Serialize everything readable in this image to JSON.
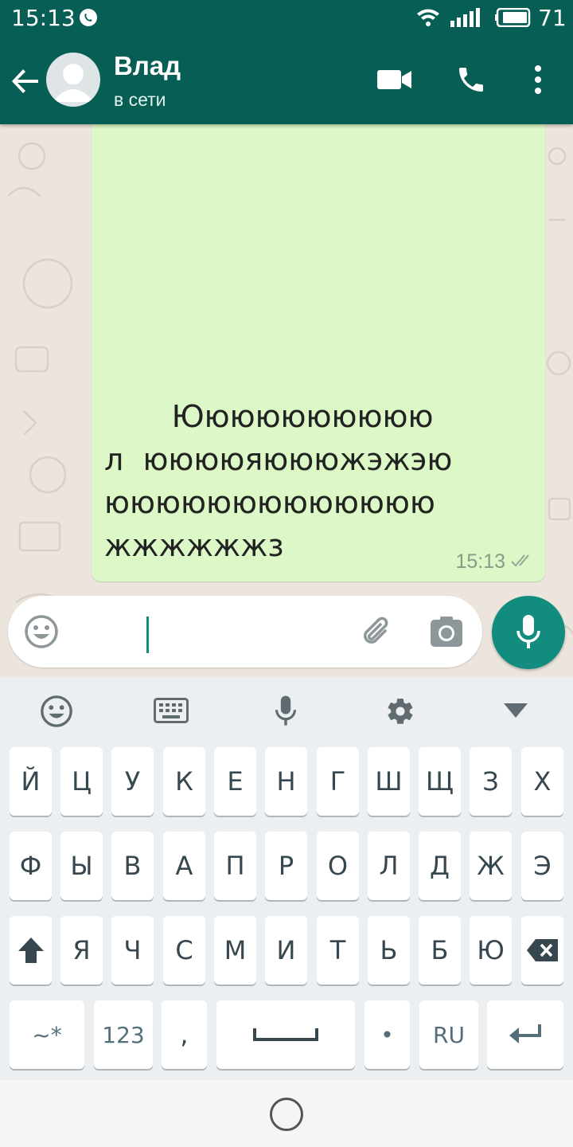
{
  "status_bar": {
    "time": "15:13",
    "battery_level": "71",
    "icons": [
      "viber-icon",
      "wifi-icon",
      "signal-icon",
      "battery-icon"
    ]
  },
  "header": {
    "contact_name": "Влад",
    "contact_status": "в сети",
    "actions": [
      "back-arrow-icon",
      "video-call-icon",
      "phone-call-icon",
      "more-options-icon"
    ]
  },
  "message": {
    "text": "       Юююююююююю\nл  ююююяюююжэжэю\nююююююююююююю\nжжжжжжз",
    "time": "15:13",
    "status": "double-check-icon"
  },
  "composer": {
    "value": "",
    "placeholder": "",
    "icons": [
      "emoji-icon",
      "attach-icon",
      "camera-icon",
      "mic-icon"
    ]
  },
  "keyboard": {
    "toolbar": [
      "emoji-icon",
      "keyboard-icon",
      "voice-icon",
      "settings-icon",
      "collapse-icon"
    ],
    "row1": [
      "Й",
      "Ц",
      "У",
      "К",
      "Е",
      "Н",
      "Г",
      "Ш",
      "Щ",
      "З",
      "Х"
    ],
    "row2": [
      "Ф",
      "Ы",
      "В",
      "А",
      "П",
      "Р",
      "О",
      "Л",
      "Д",
      "Ж",
      "Э"
    ],
    "row3": [
      "Я",
      "Ч",
      "С",
      "М",
      "И",
      "Т",
      "Ь",
      "Б",
      "Ю"
    ],
    "symbols_label": "~*",
    "numbers_label": "123",
    "comma_label": ",",
    "period_label": "•",
    "language_label": "RU"
  },
  "colors": {
    "header": "#075e54",
    "accent": "#128c7e",
    "bubble": "#dcf8c6",
    "chat_background": "#ece5dd",
    "keyboard_background": "#eceff1"
  }
}
